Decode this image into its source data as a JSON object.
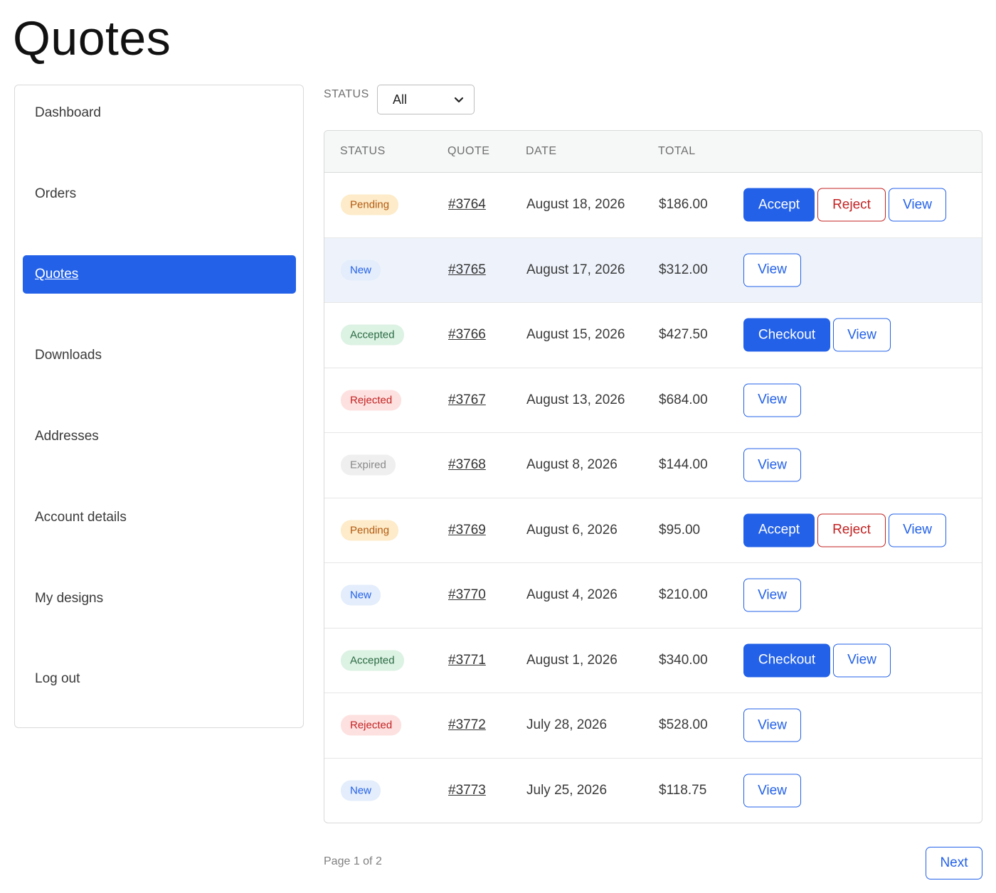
{
  "page": {
    "title": "Quotes"
  },
  "sidebar": {
    "items": [
      {
        "label": "Dashboard",
        "active": false
      },
      {
        "label": "Orders",
        "active": false
      },
      {
        "label": "Quotes",
        "active": true
      },
      {
        "label": "Downloads",
        "active": false
      },
      {
        "label": "Addresses",
        "active": false
      },
      {
        "label": "Account details",
        "active": false
      },
      {
        "label": "My designs",
        "active": false
      },
      {
        "label": "Log out",
        "active": false
      }
    ]
  },
  "filter": {
    "label": "STATUS",
    "selected": "All"
  },
  "table": {
    "headers": {
      "status": "STATUS",
      "quote": "QUOTE",
      "date": "DATE",
      "total": "TOTAL"
    },
    "rows": [
      {
        "status": "Pending",
        "status_key": "pending",
        "quote": "#3764",
        "date": "August 18, 2026",
        "total": "$186.00",
        "actions": [
          "Accept",
          "Reject",
          "View"
        ]
      },
      {
        "status": "New",
        "status_key": "new",
        "quote": "#3765",
        "date": "August 17, 2026",
        "total": "$312.00",
        "actions": [
          "View"
        ],
        "highlighted": true
      },
      {
        "status": "Accepted",
        "status_key": "accepted",
        "quote": "#3766",
        "date": "August 15, 2026",
        "total": "$427.50",
        "actions": [
          "Checkout",
          "View"
        ]
      },
      {
        "status": "Rejected",
        "status_key": "rejected",
        "quote": "#3767",
        "date": "August 13, 2026",
        "total": "$684.00",
        "actions": [
          "View"
        ]
      },
      {
        "status": "Expired",
        "status_key": "expired",
        "quote": "#3768",
        "date": "August 8, 2026",
        "total": "$144.00",
        "actions": [
          "View"
        ]
      },
      {
        "status": "Pending",
        "status_key": "pending",
        "quote": "#3769",
        "date": "August 6, 2026",
        "total": "$95.00",
        "actions": [
          "Accept",
          "Reject",
          "View"
        ]
      },
      {
        "status": "New",
        "status_key": "new",
        "quote": "#3770",
        "date": "August 4, 2026",
        "total": "$210.00",
        "actions": [
          "View"
        ]
      },
      {
        "status": "Accepted",
        "status_key": "accepted",
        "quote": "#3771",
        "date": "August 1, 2026",
        "total": "$340.00",
        "actions": [
          "Checkout",
          "View"
        ]
      },
      {
        "status": "Rejected",
        "status_key": "rejected",
        "quote": "#3772",
        "date": "July 28, 2026",
        "total": "$528.00",
        "actions": [
          "View"
        ]
      },
      {
        "status": "New",
        "status_key": "new",
        "quote": "#3773",
        "date": "July 25, 2026",
        "total": "$118.75",
        "actions": [
          "View"
        ]
      }
    ]
  },
  "pagination": {
    "text": "Page 1 of 2",
    "next_label": "Next"
  },
  "colors": {
    "primary": "#2361e8",
    "danger": "#c32222",
    "highlight_row": "#eef3fb"
  }
}
